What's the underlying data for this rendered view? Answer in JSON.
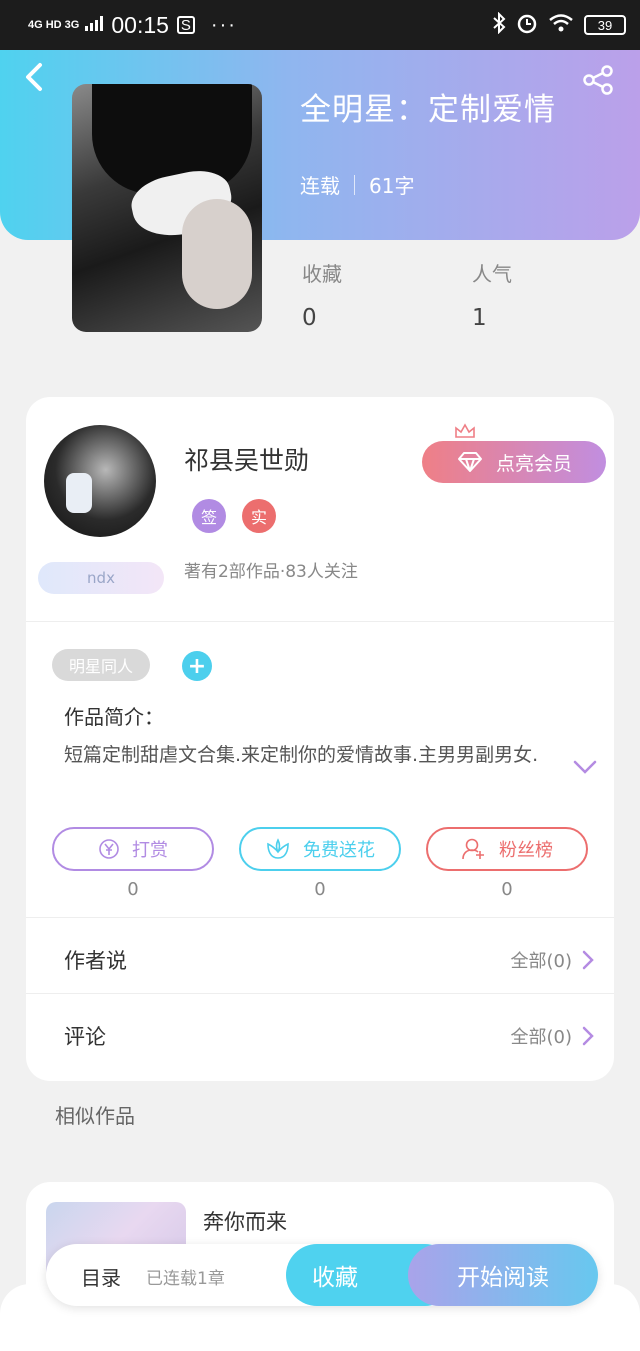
{
  "status_bar": {
    "network": "4G HD 3G",
    "time": "00:15",
    "app_icon": "S",
    "more": "···",
    "battery": "39",
    "icons": [
      "bluetooth-icon",
      "alarm-icon",
      "wifi-icon"
    ]
  },
  "book": {
    "title": "全明星：定制爱情",
    "status": "连载",
    "word_count": "61字",
    "stats": [
      {
        "label": "收藏",
        "value": "0"
      },
      {
        "label": "人气",
        "value": "1"
      }
    ]
  },
  "author": {
    "name": "祁县吴世勋",
    "member_button": "点亮会员",
    "badges": [
      {
        "text": "签",
        "color": "#b18be3"
      },
      {
        "text": "实",
        "color": "#ec6e6e"
      }
    ],
    "works_summary": "著有2部作品·83人关注",
    "tag": "ndx"
  },
  "tags": {
    "genre": "明星同人",
    "add": "+"
  },
  "intro": {
    "title": "作品简介：",
    "text": "短篇定制甜虐文合集.来定制你的爱情故事.主男男副男女."
  },
  "actions": [
    {
      "label": "打赏",
      "icon": "yen-icon",
      "count": "0",
      "color": "#b18be3"
    },
    {
      "label": "免费送花",
      "icon": "flower-icon",
      "count": "0",
      "color": "#4ccfed"
    },
    {
      "label": "粉丝榜",
      "icon": "fan-icon",
      "count": "0",
      "color": "#ec6e6e"
    }
  ],
  "rows": [
    {
      "title": "作者说",
      "more": "全部(0)"
    },
    {
      "title": "评论",
      "more": "全部(0)"
    }
  ],
  "similar": {
    "heading": "相似作品",
    "items": [
      {
        "title": "奔你而来"
      }
    ]
  },
  "bottom_bar": {
    "directory": "目录",
    "chapters": "已连载1章",
    "favorite": "收藏",
    "read": "开始阅读"
  },
  "colors": {
    "accent_cyan": "#4fd2ef",
    "accent_purple": "#bba0ea",
    "accent_pink": "#ef7f86"
  }
}
